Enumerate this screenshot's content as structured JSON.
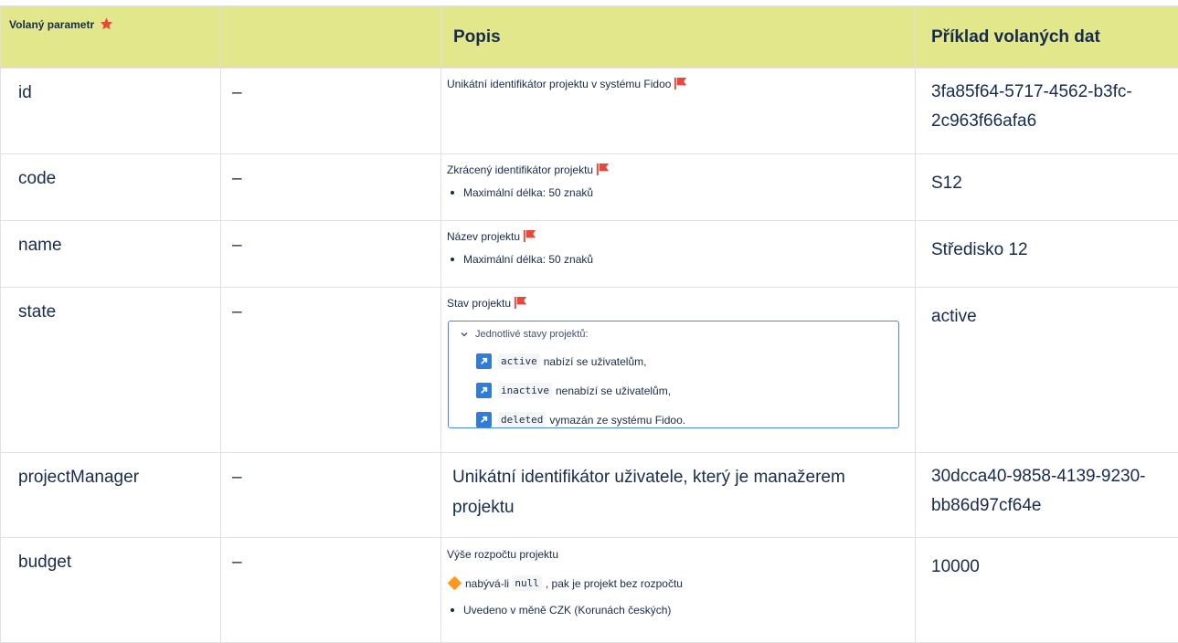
{
  "header": {
    "param": "Volaný parametr",
    "empty": "",
    "desc": "Popis",
    "example": "Příklad volaných dat"
  },
  "rows": [
    {
      "name": "id",
      "dash": "–",
      "desc": "Unikátní identifikátor projektu v systému Fidoo",
      "example": "3fa85f64-5717-4562-b3fc-2c963f66afa6"
    },
    {
      "name": "code",
      "dash": "–",
      "desc": "Zkrácený identifikátor projektu",
      "bullet": "Maximální délka: 50 znaků",
      "example": "S12"
    },
    {
      "name": "name",
      "dash": "–",
      "desc": "Název projektu",
      "bullet": "Maximální délka: 50 znaků",
      "example": "Středisko 12"
    },
    {
      "name": "state",
      "dash": "–",
      "desc": "Stav projektu",
      "expand_title": "Jednotlivé stavy projektů:",
      "states": [
        {
          "code": "active",
          "text": "nabízí se uživatelům,"
        },
        {
          "code": "inactive",
          "text": "nenabízí se uživatelům,"
        },
        {
          "code": "deleted",
          "text": "vymazán ze systému Fidoo."
        }
      ],
      "example": "active"
    },
    {
      "name": "projectManager",
      "dash": "–",
      "desc": "Unikátní identifikátor uživatele, který je manažerem projektu",
      "example": "30dcca40-9858-4139-9230-bb86d97cf64e"
    },
    {
      "name": "budget",
      "dash": "–",
      "desc": "Výše rozpočtu projektu",
      "note_pre": "nabývá-li",
      "note_code": "null",
      "note_post": ", pak je projekt bez rozpočtu",
      "bullet": "Uvedeno v měně CZK (Korunách českých)",
      "example": "10000"
    }
  ],
  "colors": {
    "header_bg": "#e3e78c",
    "flag": "#e5493a",
    "star": "#e5493a",
    "state_icon": "#2e7dd7",
    "note_icon": "#ff991f",
    "expand_border": "#4a86e8"
  },
  "icons": {
    "star": "star-icon",
    "flag": "flag-icon",
    "arrow": "arrow-up-right-icon",
    "chevron": "chevron-down-icon",
    "note": "diamond-icon"
  }
}
